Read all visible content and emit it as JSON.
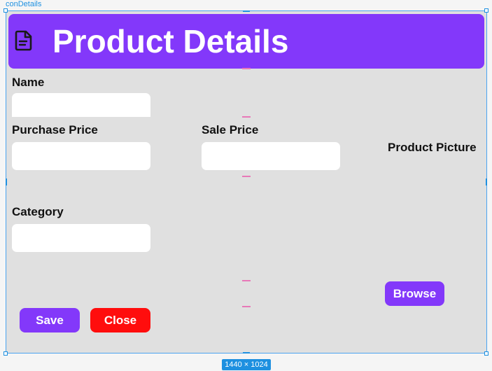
{
  "frame": {
    "name": "conDetails",
    "size_label": "1440 × 1024"
  },
  "header": {
    "icon": "document-icon",
    "title": "Product Details",
    "color": "#8338fa"
  },
  "form": {
    "name_label": "Name",
    "name_value": "",
    "purchase_price_label": "Purchase Price",
    "purchase_price_value": "",
    "sale_price_label": "Sale Price",
    "sale_price_value": "",
    "category_label": "Category",
    "category_value": "",
    "picture_label": "Product Picture"
  },
  "buttons": {
    "browse_label": "Browse",
    "save_label": "Save",
    "close_label": "Close",
    "primary_color": "#8338fa",
    "danger_color": "#ff0d0d"
  }
}
